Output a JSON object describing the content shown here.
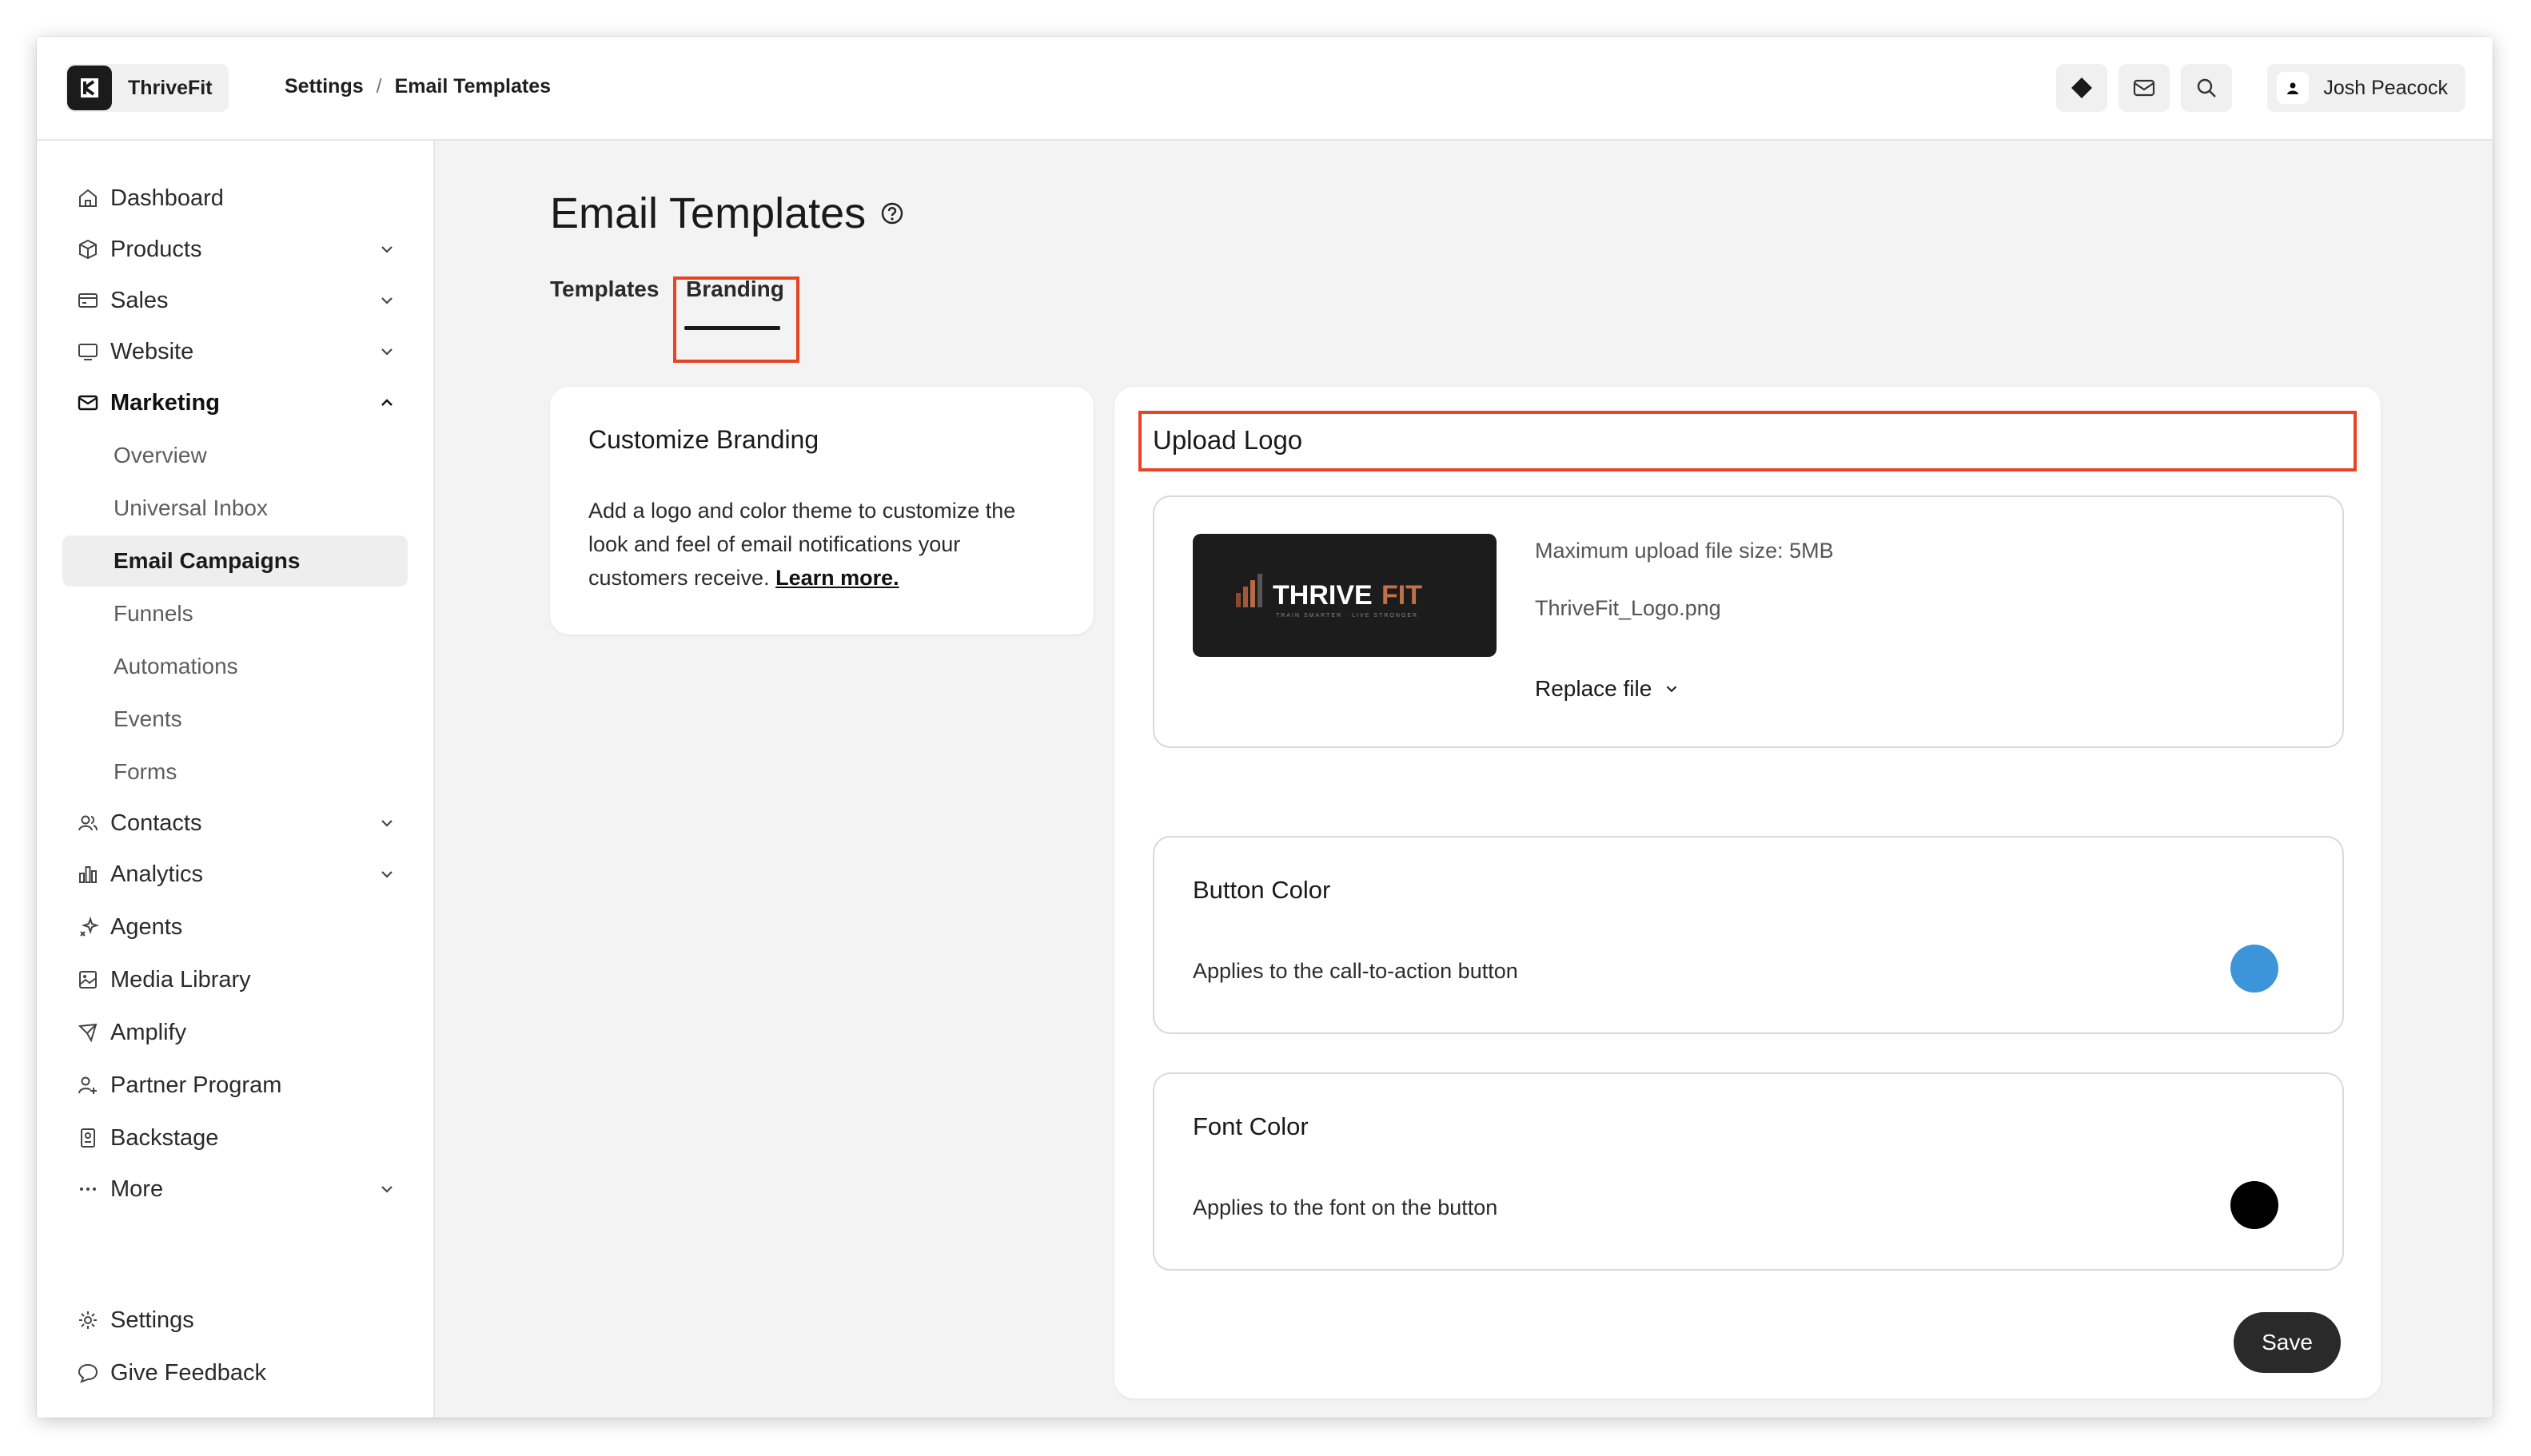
{
  "app": {
    "name": "ThriveFit"
  },
  "breadcrumb": {
    "parent": "Settings",
    "separator": "/",
    "current": "Email Templates"
  },
  "topbar": {
    "icons": [
      "diamond-icon",
      "mail-icon",
      "search-icon"
    ],
    "user_name": "Josh Peacock"
  },
  "sidebar": {
    "items": [
      {
        "label": "Dashboard",
        "icon": "home-icon"
      },
      {
        "label": "Products",
        "icon": "box-icon"
      },
      {
        "label": "Sales",
        "icon": "card-icon"
      },
      {
        "label": "Website",
        "icon": "monitor-icon"
      },
      {
        "label": "Marketing",
        "icon": "mail-icon"
      },
      {
        "label": "Contacts",
        "icon": "users-icon"
      },
      {
        "label": "Analytics",
        "icon": "bar-chart-icon"
      },
      {
        "label": "Agents",
        "icon": "sparkle-icon"
      },
      {
        "label": "Media Library",
        "icon": "image-icon"
      },
      {
        "label": "Amplify",
        "icon": "send-icon"
      },
      {
        "label": "Partner Program",
        "icon": "user-plus-icon"
      },
      {
        "label": "Backstage",
        "icon": "badge-icon"
      },
      {
        "label": "More",
        "icon": "ellipsis-icon"
      }
    ],
    "marketing_sub": [
      "Overview",
      "Universal Inbox",
      "Email Campaigns",
      "Funnels",
      "Automations",
      "Events",
      "Forms"
    ],
    "footer": [
      {
        "label": "Settings",
        "icon": "gear-icon"
      },
      {
        "label": "Give Feedback",
        "icon": "chat-icon"
      }
    ]
  },
  "main": {
    "title": "Email Templates",
    "tabs": [
      "Templates",
      "Branding"
    ],
    "active_tab": "Branding",
    "customize": {
      "title": "Customize Branding",
      "body": "Add a logo and color theme to customize the look and feel of email notifications your customers receive.",
      "link": "Learn more."
    },
    "upload": {
      "title": "Upload Logo",
      "max_size": "Maximum upload file size: 5MB",
      "file_name": "ThriveFit_Logo.png",
      "replace_label": "Replace file",
      "logo_text_a": "THRIVE",
      "logo_text_b": "FIT",
      "logo_tagline": "TRAIN SMARTER · LIVE STRONGER"
    },
    "button_color": {
      "title": "Button Color",
      "description": "Applies to the call-to-action button",
      "color": "#3b95d8"
    },
    "font_color": {
      "title": "Font Color",
      "description": "Applies to the font on the button",
      "color": "#000000"
    },
    "save_label": "Save"
  }
}
